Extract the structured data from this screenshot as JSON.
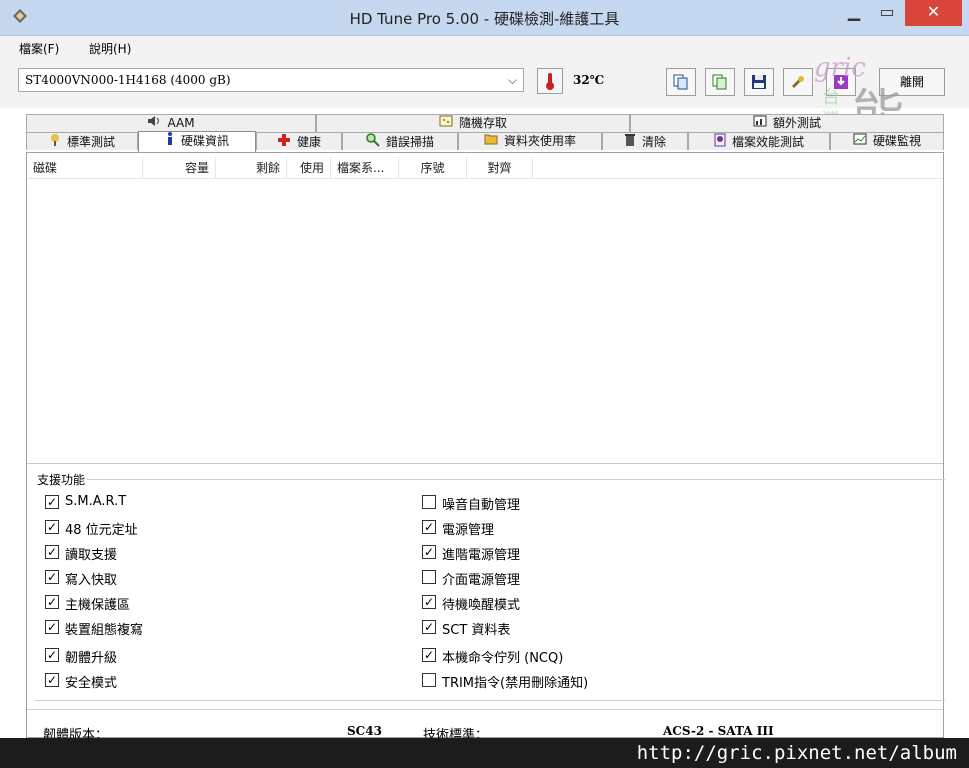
{
  "window": {
    "title": "HD Tune Pro  5.00 - 硬碟檢測-維護工具"
  },
  "menu": {
    "file": "檔案(F)",
    "help": "說明(H)"
  },
  "toolbar": {
    "drive": "ST4000VN000-1H4168 (4000 gB)",
    "temperature": "32℃",
    "exit_label": "離開"
  },
  "tabs_top": [
    {
      "label": "AAM",
      "icon": "speaker-icon"
    },
    {
      "label": "隨機存取",
      "icon": "random-access-icon"
    },
    {
      "label": "額外測試",
      "icon": "extra-tests-icon"
    }
  ],
  "tabs_bottom": [
    {
      "label": "標準測試",
      "icon": "benchmark-icon"
    },
    {
      "label": "硬碟資訊",
      "icon": "info-icon",
      "active": true
    },
    {
      "label": "健康",
      "icon": "health-cross-icon"
    },
    {
      "label": "錯誤掃描",
      "icon": "magnifier-icon"
    },
    {
      "label": "資料夾使用率",
      "icon": "folder-icon"
    },
    {
      "label": "清除",
      "icon": "trash-icon"
    },
    {
      "label": "檔案效能測試",
      "icon": "file-benchmark-icon"
    },
    {
      "label": "硬碟監視",
      "icon": "monitor-chart-icon"
    }
  ],
  "columns": [
    "磁碟",
    "容量",
    "剩餘",
    "使用",
    "檔案系...",
    "序號",
    "對齊"
  ],
  "features": {
    "title": "支援功能",
    "left": [
      {
        "label": "S.M.A.R.T",
        "checked": true
      },
      {
        "label": "48 位元定址",
        "checked": true
      },
      {
        "label": "讀取支援",
        "checked": true
      },
      {
        "label": "寫入快取",
        "checked": true
      },
      {
        "label": "主機保護區",
        "checked": true
      },
      {
        "label": "裝置組態複寫",
        "checked": true
      },
      {
        "label": "韌體升級",
        "checked": true
      },
      {
        "label": "安全模式",
        "checked": true
      }
    ],
    "right": [
      {
        "label": "噪音自動管理",
        "checked": false
      },
      {
        "label": "電源管理",
        "checked": true
      },
      {
        "label": "進階電源管理",
        "checked": true
      },
      {
        "label": "介面電源管理",
        "checked": false
      },
      {
        "label": "待機喚醒模式",
        "checked": true
      },
      {
        "label": "SCT 資料表",
        "checked": true
      },
      {
        "label": "本機命令佇列 (NCQ)",
        "checked": true
      },
      {
        "label": "TRIM指令(禁用刪除通知)",
        "checked": false
      }
    ]
  },
  "info": {
    "firmware_label": "韌體版本：",
    "firmware_value": "SC43",
    "standard_label": "技術標準：",
    "standard_value": "ACS-2 - SATA III"
  },
  "watermark": {
    "url": "http://gric.pixnet.net/album",
    "logo_text": "gric 台灣 能"
  },
  "colors": {
    "close_button": "#d9443b",
    "titlebar": "#c5d8ef"
  }
}
